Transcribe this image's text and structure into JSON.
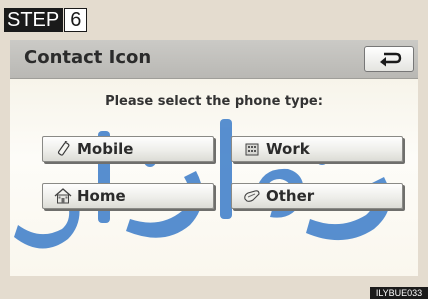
{
  "step": {
    "label": "STEP",
    "number": "6"
  },
  "screen": {
    "title": "Contact Icon",
    "back_icon": "return-arrow-icon",
    "prompt": "Please select the phone type:",
    "options": [
      {
        "label": "Mobile",
        "icon": "mobile-phone-icon"
      },
      {
        "label": "Work",
        "icon": "office-building-icon"
      },
      {
        "label": "Home",
        "icon": "house-icon"
      },
      {
        "label": "Other",
        "icon": "other-phone-icon"
      }
    ]
  },
  "image_code": "ILYBUE033",
  "colors": {
    "background": "#e4dccf",
    "title_bar": "#c4c3bf",
    "content": "#fbfaf6",
    "watermark": "#3b7cc9"
  }
}
